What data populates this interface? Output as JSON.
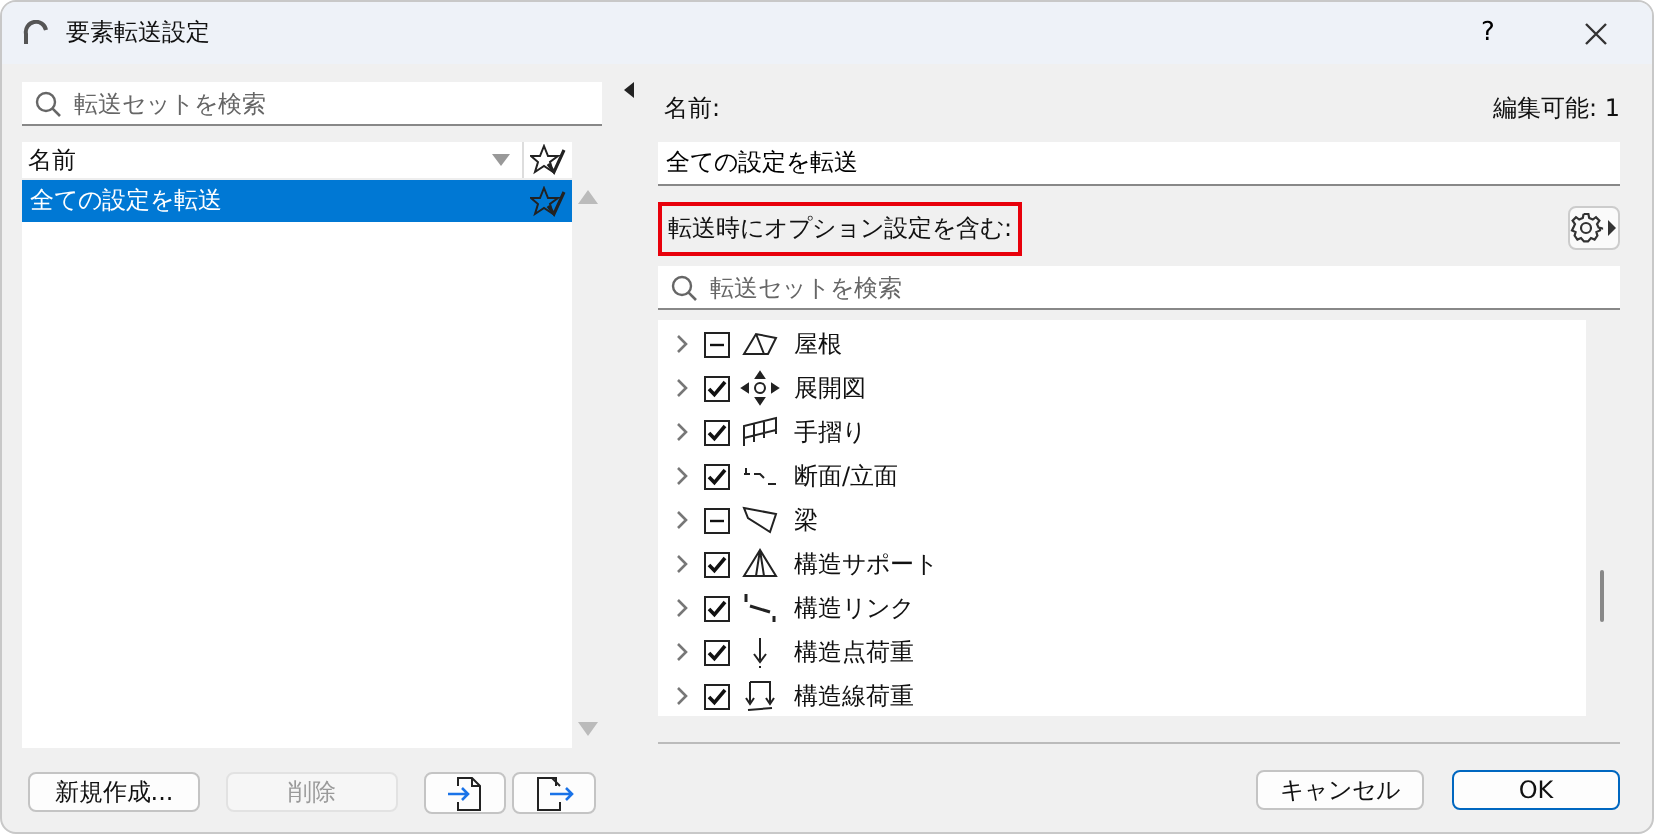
{
  "window": {
    "title": "要素転送設定",
    "help": "?"
  },
  "left": {
    "search": {
      "placeholder": "転送セットを検索"
    },
    "list_header": "名前",
    "sets": [
      {
        "name": "全ての設定を転送",
        "selected": true
      }
    ],
    "buttons": [
      {
        "kind": "text",
        "label": "新規作成...",
        "disabled": false
      },
      {
        "kind": "text",
        "label": "削除",
        "disabled": true
      },
      {
        "kind": "import",
        "disabled": false
      },
      {
        "kind": "export",
        "disabled": false
      }
    ]
  },
  "right": {
    "name_label": "名前:",
    "editable": "編集可能: 1",
    "name_value": "全ての設定を転送",
    "options_label": "転送時にオプション設定を含む:",
    "options_highlighted": true,
    "search": {
      "placeholder": "転送セットを検索"
    },
    "tree": [
      {
        "label": "屋根",
        "checked": true,
        "indeterminate": true,
        "expanded": false
      },
      {
        "label": "展開図",
        "checked": true,
        "indeterminate": false,
        "expanded": false
      },
      {
        "label": "手摺り",
        "checked": true,
        "indeterminate": false,
        "expanded": false
      },
      {
        "label": "断面/立面",
        "checked": true,
        "indeterminate": false,
        "expanded": false
      },
      {
        "label": "梁",
        "checked": true,
        "indeterminate": true,
        "expanded": false
      },
      {
        "label": "構造サポート",
        "checked": true,
        "indeterminate": false,
        "expanded": false
      },
      {
        "label": "構造リンク",
        "checked": true,
        "indeterminate": false,
        "expanded": false
      },
      {
        "label": "構造点荷重",
        "checked": true,
        "indeterminate": false,
        "expanded": false
      },
      {
        "label": "構造線荷重",
        "checked": true,
        "indeterminate": false,
        "expanded": false
      }
    ]
  },
  "footer": {
    "buttons": [
      {
        "label": "キャンセル",
        "default": false
      },
      {
        "label": "OK",
        "default": true
      }
    ]
  }
}
